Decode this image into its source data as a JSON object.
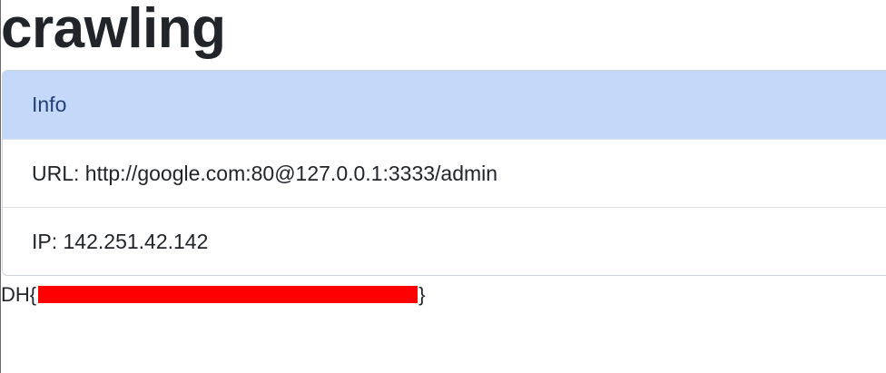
{
  "page": {
    "title": "crawling"
  },
  "info_panel": {
    "header": "Info",
    "url_text": "URL: http://google.com:80@127.0.0.1:3333/admin",
    "ip_text": "IP: 142.251.42.142"
  },
  "flag": {
    "prefix": "DH{",
    "suffix": "}"
  },
  "colors": {
    "header_bg": "#c4d8fa",
    "header_text": "#243f74",
    "redaction": "#ff0000"
  }
}
